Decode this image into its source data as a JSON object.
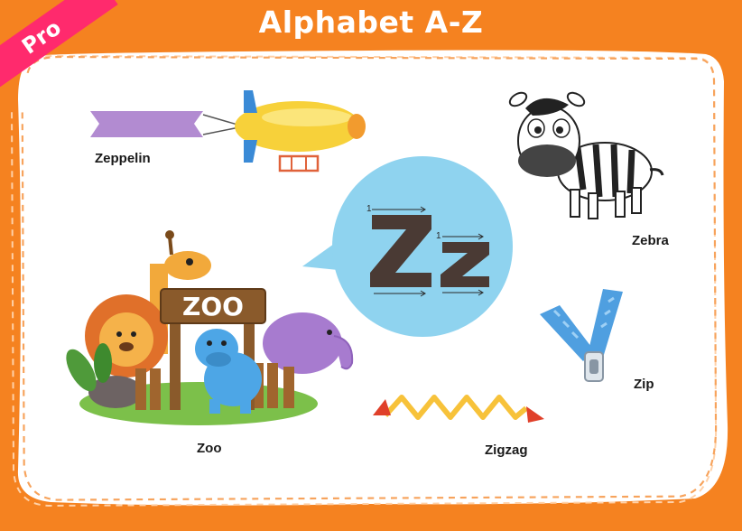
{
  "header": {
    "title": "Alphabet A-Z"
  },
  "badge": {
    "label": "Pro"
  },
  "letter": {
    "upper": "Z",
    "lower": "z"
  },
  "words": {
    "zeppelin": "Zeppelin",
    "zebra": "Zebra",
    "zoo": "Zoo",
    "zip": "Zip",
    "zigzag": "Zigzag"
  },
  "sign": {
    "text": "ZOO"
  },
  "stroke_numbers": {
    "upper": "1",
    "lower": "1"
  },
  "colors": {
    "background": "#f58220",
    "card": "#ffffff",
    "bubble": "#8fd3ef",
    "letter": "#4a3a34",
    "badge": "#ff2a6d"
  }
}
